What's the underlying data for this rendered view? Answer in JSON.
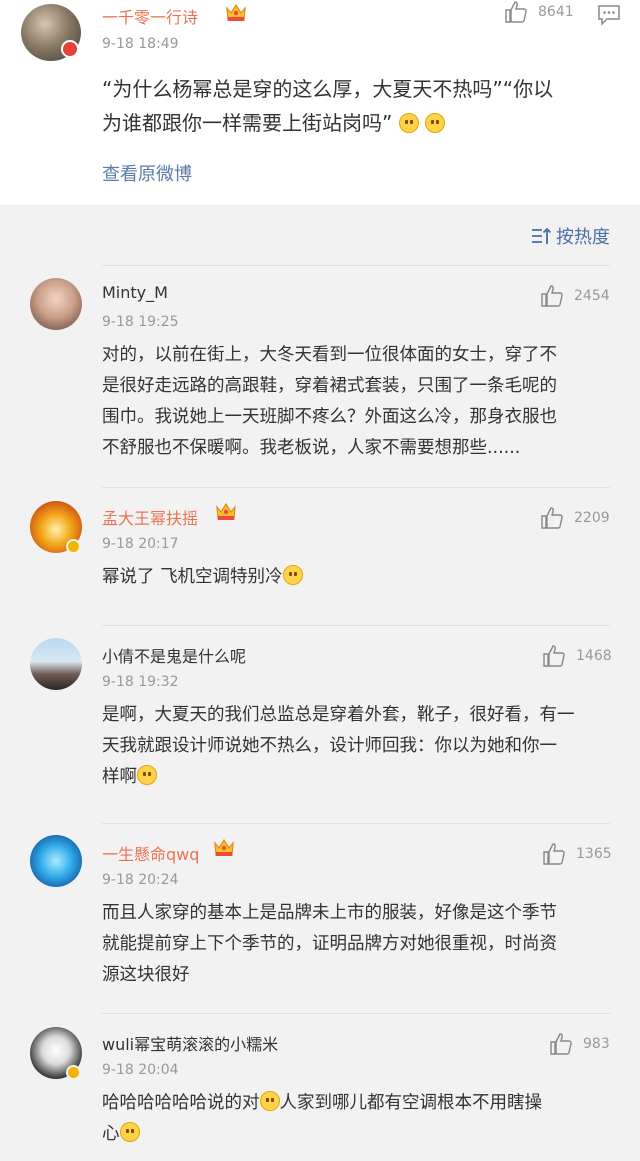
{
  "main_post": {
    "author": "一千零一行诗",
    "time": "9-18 18:49",
    "likes": "8641",
    "text_line1": "“为什么杨幂总是穿的这么厚，大夏天不热吗”“你以",
    "text_line2": "为谁都跟你一样需要上街站岗吗”",
    "view_original": "查看原微博"
  },
  "sort": {
    "label": "按热度"
  },
  "comments": [
    {
      "name": "Minty_M",
      "time": "9-18 19:25",
      "likes": "2454",
      "lines": [
        "对的，以前在街上，大冬天看到一位很体面的女士，穿了不",
        "是很好走远路的高跟鞋，穿着裙式套装，只围了一条毛呢的",
        "围巾。我说她上一天班脚不疼么？外面这么冷，那身衣服也",
        "不舒服也不保暖啊。我老板说，人家不需要想那些......"
      ]
    },
    {
      "name": "孟大王幂扶摇",
      "time": "9-18 20:17",
      "likes": "2209",
      "lines": [
        "幂说了 飞机空调特别冷"
      ]
    },
    {
      "name": "小倩不是鬼是什么呢",
      "time": "9-18 19:32",
      "likes": "1468",
      "lines": [
        "是啊，大夏天的我们总监总是穿着外套，靴子，很好看，有一",
        "天我就跟设计师说她不热么，设计师回我：你以为她和你一",
        "样啊"
      ]
    },
    {
      "name": "一生懸命qwq",
      "time": "9-18 20:24",
      "likes": "1365",
      "lines": [
        "而且人家穿的基本上是品牌未上市的服装，好像是这个季节",
        "就能提前穿上下个季节的，证明品牌方对她很重视，时尚资",
        "源这块很好"
      ]
    },
    {
      "name": "wuli幂宝萌滚滚的小糯米",
      "time": "9-18 20:04",
      "likes": "983",
      "lines": [
        "哈哈哈哈哈哈说的对",
        "人家到哪儿都有空调根本不用瞎操",
        "心"
      ]
    }
  ],
  "colors": {
    "name_orange": "#eb7350",
    "link_blue": "#5b7ba6",
    "sort_blue": "#4a6ea9",
    "muted": "#999999",
    "background": "#f2f2f2"
  },
  "icons": [
    "thumb-up-icon",
    "reply-icon",
    "sort-icon",
    "crown-icon",
    "emoji-icon",
    "verified-badge-icon"
  ]
}
